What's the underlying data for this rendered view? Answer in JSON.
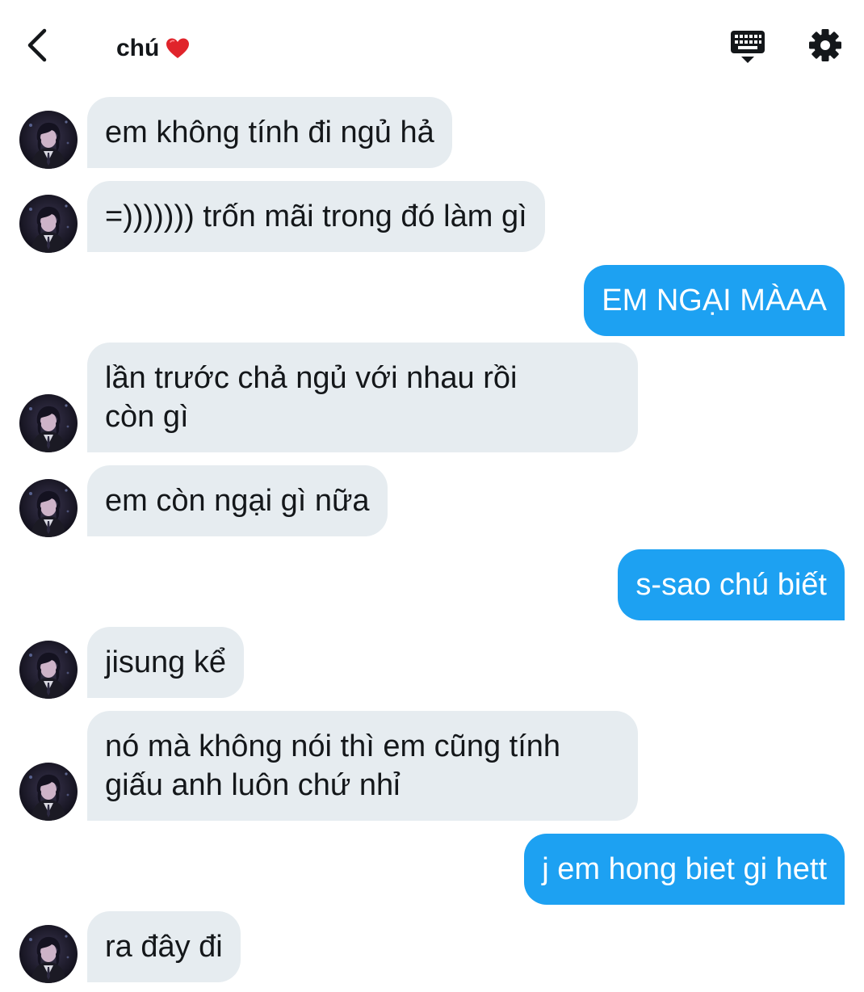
{
  "header": {
    "title": "chú",
    "back_icon": "chevron-left-icon",
    "heart_icon": "red-heart-emoji",
    "keyboard_icon": "keyboard-icon",
    "settings_icon": "gear-icon"
  },
  "colors": {
    "incoming_bubble": "#e6ecf0",
    "outgoing_bubble": "#1da1f2",
    "text": "#14171a"
  },
  "messages": [
    {
      "side": "in",
      "text": "em không tính đi ngủ hả"
    },
    {
      "side": "in",
      "text": "=))))))) trốn mãi trong đó làm gì"
    },
    {
      "side": "out",
      "text": "EM NGẠI MÀAA"
    },
    {
      "side": "in",
      "lines": [
        "lần trước chả ngủ với nhau rồi",
        "còn gì"
      ]
    },
    {
      "side": "in",
      "text": "em còn ngại gì nữa"
    },
    {
      "side": "out",
      "text": "s-sao chú biết"
    },
    {
      "side": "in",
      "text": "jisung kể"
    },
    {
      "side": "in",
      "lines": [
        "nó mà không nói thì em cũng tính",
        "giấu anh luôn chứ nhỉ"
      ]
    },
    {
      "side": "out",
      "text": "j em hong biet gi hett"
    },
    {
      "side": "in",
      "text": "ra đây đi"
    }
  ]
}
